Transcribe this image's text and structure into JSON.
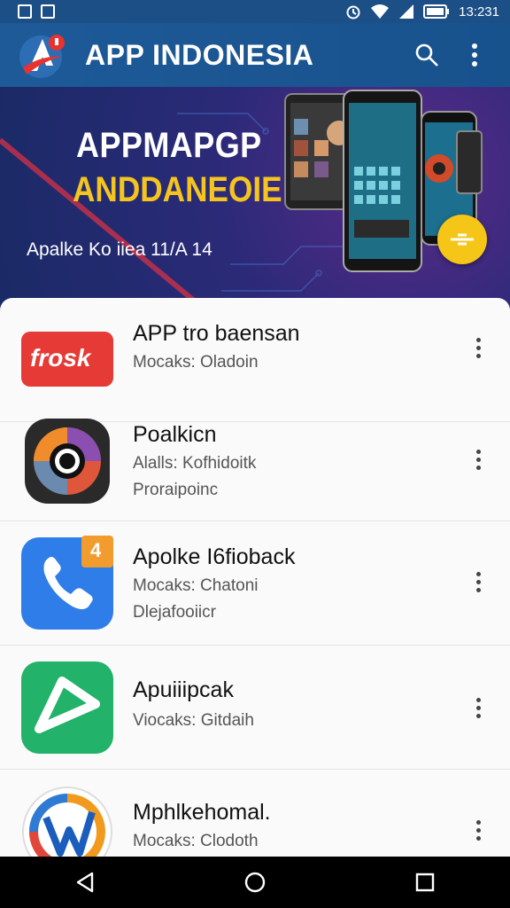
{
  "status": {
    "time": "13:231"
  },
  "appbar": {
    "title": "APP INDONESIA"
  },
  "banner": {
    "title_line1": "APPMAPGP",
    "title_line2": "ANDDANEOIE",
    "subtitle": "Apalke Ko iiea 11/A 14"
  },
  "apps": [
    {
      "name": "APP tro baensan",
      "line1": "Mocaks: Oladoin",
      "line2": "",
      "icon_label": "frosk"
    },
    {
      "name": "Poalkicn",
      "line1": "Alalls: Kofhidoitk",
      "line2": "Proraipoinc",
      "icon_label": ""
    },
    {
      "name": "Apolke I6fioback",
      "line1": "Mocaks: Chatoni",
      "line2": "Dlejafooiicr",
      "icon_label": "",
      "badge": "4"
    },
    {
      "name": "Apuiiipcak",
      "line1": "Viocaks: Gitdaih",
      "line2": "",
      "icon_label": ""
    },
    {
      "name": "Mphlkehomal.",
      "line1": "Mocaks: Clodoth",
      "line2": "",
      "icon_label": ""
    }
  ],
  "colors": {
    "primary": "#1e5a98",
    "accent": "#f5c518",
    "banner": "#2b2a78"
  },
  "icons": [
    "sim-icon",
    "save-icon",
    "alarm-icon",
    "wifi-icon",
    "signal-icon",
    "battery-icon",
    "search-icon",
    "more-vert-icon",
    "back-icon",
    "home-icon",
    "recents-icon"
  ]
}
